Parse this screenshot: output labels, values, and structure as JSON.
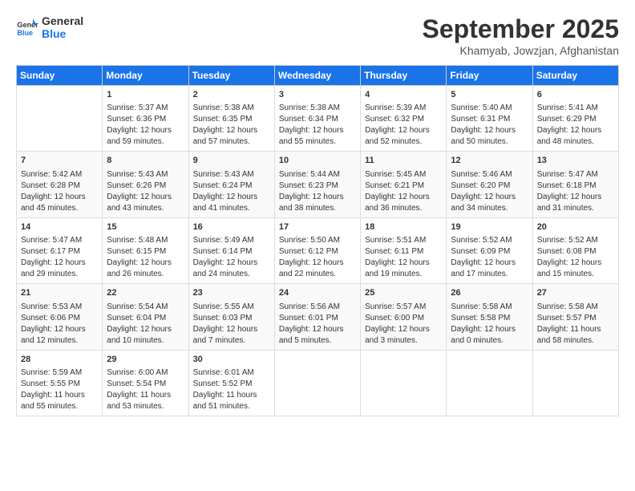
{
  "header": {
    "logo_line1": "General",
    "logo_line2": "Blue",
    "month_title": "September 2025",
    "location": "Khamyab, Jowzjan, Afghanistan"
  },
  "days_of_week": [
    "Sunday",
    "Monday",
    "Tuesday",
    "Wednesday",
    "Thursday",
    "Friday",
    "Saturday"
  ],
  "weeks": [
    [
      {
        "day": "",
        "content": ""
      },
      {
        "day": "1",
        "content": "Sunrise: 5:37 AM\nSunset: 6:36 PM\nDaylight: 12 hours\nand 59 minutes."
      },
      {
        "day": "2",
        "content": "Sunrise: 5:38 AM\nSunset: 6:35 PM\nDaylight: 12 hours\nand 57 minutes."
      },
      {
        "day": "3",
        "content": "Sunrise: 5:38 AM\nSunset: 6:34 PM\nDaylight: 12 hours\nand 55 minutes."
      },
      {
        "day": "4",
        "content": "Sunrise: 5:39 AM\nSunset: 6:32 PM\nDaylight: 12 hours\nand 52 minutes."
      },
      {
        "day": "5",
        "content": "Sunrise: 5:40 AM\nSunset: 6:31 PM\nDaylight: 12 hours\nand 50 minutes."
      },
      {
        "day": "6",
        "content": "Sunrise: 5:41 AM\nSunset: 6:29 PM\nDaylight: 12 hours\nand 48 minutes."
      }
    ],
    [
      {
        "day": "7",
        "content": "Sunrise: 5:42 AM\nSunset: 6:28 PM\nDaylight: 12 hours\nand 45 minutes."
      },
      {
        "day": "8",
        "content": "Sunrise: 5:43 AM\nSunset: 6:26 PM\nDaylight: 12 hours\nand 43 minutes."
      },
      {
        "day": "9",
        "content": "Sunrise: 5:43 AM\nSunset: 6:24 PM\nDaylight: 12 hours\nand 41 minutes."
      },
      {
        "day": "10",
        "content": "Sunrise: 5:44 AM\nSunset: 6:23 PM\nDaylight: 12 hours\nand 38 minutes."
      },
      {
        "day": "11",
        "content": "Sunrise: 5:45 AM\nSunset: 6:21 PM\nDaylight: 12 hours\nand 36 minutes."
      },
      {
        "day": "12",
        "content": "Sunrise: 5:46 AM\nSunset: 6:20 PM\nDaylight: 12 hours\nand 34 minutes."
      },
      {
        "day": "13",
        "content": "Sunrise: 5:47 AM\nSunset: 6:18 PM\nDaylight: 12 hours\nand 31 minutes."
      }
    ],
    [
      {
        "day": "14",
        "content": "Sunrise: 5:47 AM\nSunset: 6:17 PM\nDaylight: 12 hours\nand 29 minutes."
      },
      {
        "day": "15",
        "content": "Sunrise: 5:48 AM\nSunset: 6:15 PM\nDaylight: 12 hours\nand 26 minutes."
      },
      {
        "day": "16",
        "content": "Sunrise: 5:49 AM\nSunset: 6:14 PM\nDaylight: 12 hours\nand 24 minutes."
      },
      {
        "day": "17",
        "content": "Sunrise: 5:50 AM\nSunset: 6:12 PM\nDaylight: 12 hours\nand 22 minutes."
      },
      {
        "day": "18",
        "content": "Sunrise: 5:51 AM\nSunset: 6:11 PM\nDaylight: 12 hours\nand 19 minutes."
      },
      {
        "day": "19",
        "content": "Sunrise: 5:52 AM\nSunset: 6:09 PM\nDaylight: 12 hours\nand 17 minutes."
      },
      {
        "day": "20",
        "content": "Sunrise: 5:52 AM\nSunset: 6:08 PM\nDaylight: 12 hours\nand 15 minutes."
      }
    ],
    [
      {
        "day": "21",
        "content": "Sunrise: 5:53 AM\nSunset: 6:06 PM\nDaylight: 12 hours\nand 12 minutes."
      },
      {
        "day": "22",
        "content": "Sunrise: 5:54 AM\nSunset: 6:04 PM\nDaylight: 12 hours\nand 10 minutes."
      },
      {
        "day": "23",
        "content": "Sunrise: 5:55 AM\nSunset: 6:03 PM\nDaylight: 12 hours\nand 7 minutes."
      },
      {
        "day": "24",
        "content": "Sunrise: 5:56 AM\nSunset: 6:01 PM\nDaylight: 12 hours\nand 5 minutes."
      },
      {
        "day": "25",
        "content": "Sunrise: 5:57 AM\nSunset: 6:00 PM\nDaylight: 12 hours\nand 3 minutes."
      },
      {
        "day": "26",
        "content": "Sunrise: 5:58 AM\nSunset: 5:58 PM\nDaylight: 12 hours\nand 0 minutes."
      },
      {
        "day": "27",
        "content": "Sunrise: 5:58 AM\nSunset: 5:57 PM\nDaylight: 11 hours\nand 58 minutes."
      }
    ],
    [
      {
        "day": "28",
        "content": "Sunrise: 5:59 AM\nSunset: 5:55 PM\nDaylight: 11 hours\nand 55 minutes."
      },
      {
        "day": "29",
        "content": "Sunrise: 6:00 AM\nSunset: 5:54 PM\nDaylight: 11 hours\nand 53 minutes."
      },
      {
        "day": "30",
        "content": "Sunrise: 6:01 AM\nSunset: 5:52 PM\nDaylight: 11 hours\nand 51 minutes."
      },
      {
        "day": "",
        "content": ""
      },
      {
        "day": "",
        "content": ""
      },
      {
        "day": "",
        "content": ""
      },
      {
        "day": "",
        "content": ""
      }
    ]
  ]
}
